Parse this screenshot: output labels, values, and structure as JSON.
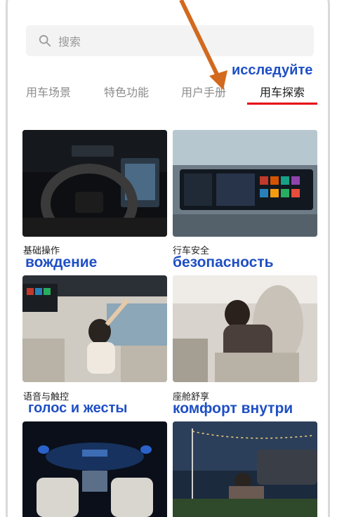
{
  "search": {
    "placeholder": "搜索",
    "icon": "search-icon"
  },
  "tabs": [
    {
      "label": "用车场景",
      "active": false
    },
    {
      "label": "特色功能",
      "active": false
    },
    {
      "label": "用户手册",
      "active": false
    },
    {
      "label": "用车探索",
      "active": true
    }
  ],
  "accent_color": "#e60012",
  "annotation_color": "#1f4fc4",
  "arrow_color": "#d2691e",
  "annotations": {
    "tab": "исследуйте",
    "card1": "вождение",
    "card2": "безопасность",
    "card3": "голос и жесты",
    "card4": "комфорт внутри"
  },
  "cards": [
    {
      "label": "基础操作"
    },
    {
      "label": "行车安全"
    },
    {
      "label": "语音与触控"
    },
    {
      "label": "座舱舒享"
    }
  ]
}
